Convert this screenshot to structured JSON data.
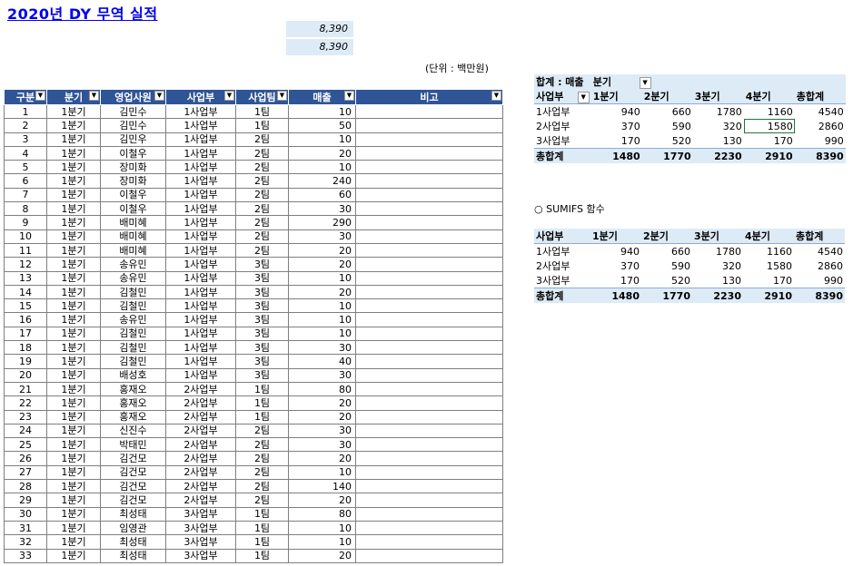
{
  "title": "2020년 DY 무역 실적",
  "summary_values": [
    "8,390",
    "8,390"
  ],
  "unit_label": "(단위 : 백만원)",
  "table": {
    "headers": [
      "구분",
      "분기",
      "영업사원",
      "사업부",
      "사업팀",
      "매출",
      "비고"
    ],
    "rows": [
      [
        "1",
        "1분기",
        "김민수",
        "1사업부",
        "1팀",
        "10"
      ],
      [
        "2",
        "1분기",
        "김민수",
        "1사업부",
        "1팀",
        "50"
      ],
      [
        "3",
        "1분기",
        "김민우",
        "1사업부",
        "2팀",
        "10"
      ],
      [
        "4",
        "1분기",
        "이철우",
        "1사업부",
        "2팀",
        "20"
      ],
      [
        "5",
        "1분기",
        "장미화",
        "1사업부",
        "2팀",
        "10"
      ],
      [
        "6",
        "1분기",
        "장미화",
        "1사업부",
        "2팀",
        "240"
      ],
      [
        "7",
        "1분기",
        "이철우",
        "1사업부",
        "2팀",
        "60"
      ],
      [
        "8",
        "1분기",
        "이철우",
        "1사업부",
        "2팀",
        "30"
      ],
      [
        "9",
        "1분기",
        "배미혜",
        "1사업부",
        "2팀",
        "290"
      ],
      [
        "10",
        "1분기",
        "배미혜",
        "1사업부",
        "2팀",
        "30"
      ],
      [
        "11",
        "1분기",
        "배미혜",
        "1사업부",
        "2팀",
        "20"
      ],
      [
        "12",
        "1분기",
        "송유민",
        "1사업부",
        "3팀",
        "20"
      ],
      [
        "13",
        "1분기",
        "송유민",
        "1사업부",
        "3팀",
        "10"
      ],
      [
        "14",
        "1분기",
        "김철민",
        "1사업부",
        "3팀",
        "20"
      ],
      [
        "15",
        "1분기",
        "김철민",
        "1사업부",
        "3팀",
        "10"
      ],
      [
        "16",
        "1분기",
        "송유민",
        "1사업부",
        "3팀",
        "10"
      ],
      [
        "17",
        "1분기",
        "김철민",
        "1사업부",
        "3팀",
        "10"
      ],
      [
        "18",
        "1분기",
        "김철민",
        "1사업부",
        "3팀",
        "30"
      ],
      [
        "19",
        "1분기",
        "김철민",
        "1사업부",
        "3팀",
        "40"
      ],
      [
        "20",
        "1분기",
        "배성호",
        "1사업부",
        "3팀",
        "30"
      ],
      [
        "21",
        "1분기",
        "홍재오",
        "2사업부",
        "1팀",
        "80"
      ],
      [
        "22",
        "1분기",
        "홍재오",
        "2사업부",
        "1팀",
        "20"
      ],
      [
        "23",
        "1분기",
        "홍재오",
        "2사업부",
        "1팀",
        "20"
      ],
      [
        "24",
        "1분기",
        "신진수",
        "2사업부",
        "2팀",
        "30"
      ],
      [
        "25",
        "1분기",
        "박태민",
        "2사업부",
        "2팀",
        "30"
      ],
      [
        "26",
        "1분기",
        "김건모",
        "2사업부",
        "2팀",
        "20"
      ],
      [
        "27",
        "1분기",
        "김건모",
        "2사업부",
        "2팀",
        "10"
      ],
      [
        "28",
        "1분기",
        "김건모",
        "2사업부",
        "2팀",
        "140"
      ],
      [
        "29",
        "1분기",
        "김건모",
        "2사업부",
        "2팀",
        "20"
      ],
      [
        "30",
        "1분기",
        "최성태",
        "3사업부",
        "1팀",
        "80"
      ],
      [
        "31",
        "1분기",
        "임영관",
        "3사업부",
        "1팀",
        "10"
      ],
      [
        "32",
        "1분기",
        "최성태",
        "3사업부",
        "1팀",
        "10"
      ],
      [
        "33",
        "1분기",
        "최성태",
        "3사업부",
        "1팀",
        "20"
      ]
    ]
  },
  "pivot": {
    "filter_label": "합계 : 매출",
    "column_field": "분기",
    "row_field": "사업부",
    "columns": [
      "1분기",
      "2분기",
      "3분기",
      "4분기",
      "총합계"
    ],
    "rows": [
      {
        "label": "1사업부",
        "values": [
          "940",
          "660",
          "1780",
          "1160",
          "4540"
        ]
      },
      {
        "label": "2사업부",
        "values": [
          "370",
          "590",
          "320",
          "1580",
          "2860"
        ]
      },
      {
        "label": "3사업부",
        "values": [
          "170",
          "520",
          "130",
          "170",
          "990"
        ]
      }
    ],
    "total": {
      "label": "총합계",
      "values": [
        "1480",
        "1770",
        "2230",
        "2910",
        "8390"
      ]
    }
  },
  "sumifs": {
    "label": "○ SUMIFS 함수",
    "row_header": "사업부",
    "columns": [
      "1분기",
      "2분기",
      "3분기",
      "4분기",
      "총합계"
    ],
    "rows": [
      {
        "label": "1사업부",
        "values": [
          "940",
          "660",
          "1780",
          "1160",
          "4540"
        ]
      },
      {
        "label": "2사업부",
        "values": [
          "370",
          "590",
          "320",
          "1580",
          "2860"
        ]
      },
      {
        "label": "3사업부",
        "values": [
          "170",
          "520",
          "130",
          "170",
          "990"
        ]
      }
    ],
    "total": {
      "label": "총합계",
      "values": [
        "1480",
        "1770",
        "2230",
        "2910",
        "8390"
      ]
    }
  }
}
